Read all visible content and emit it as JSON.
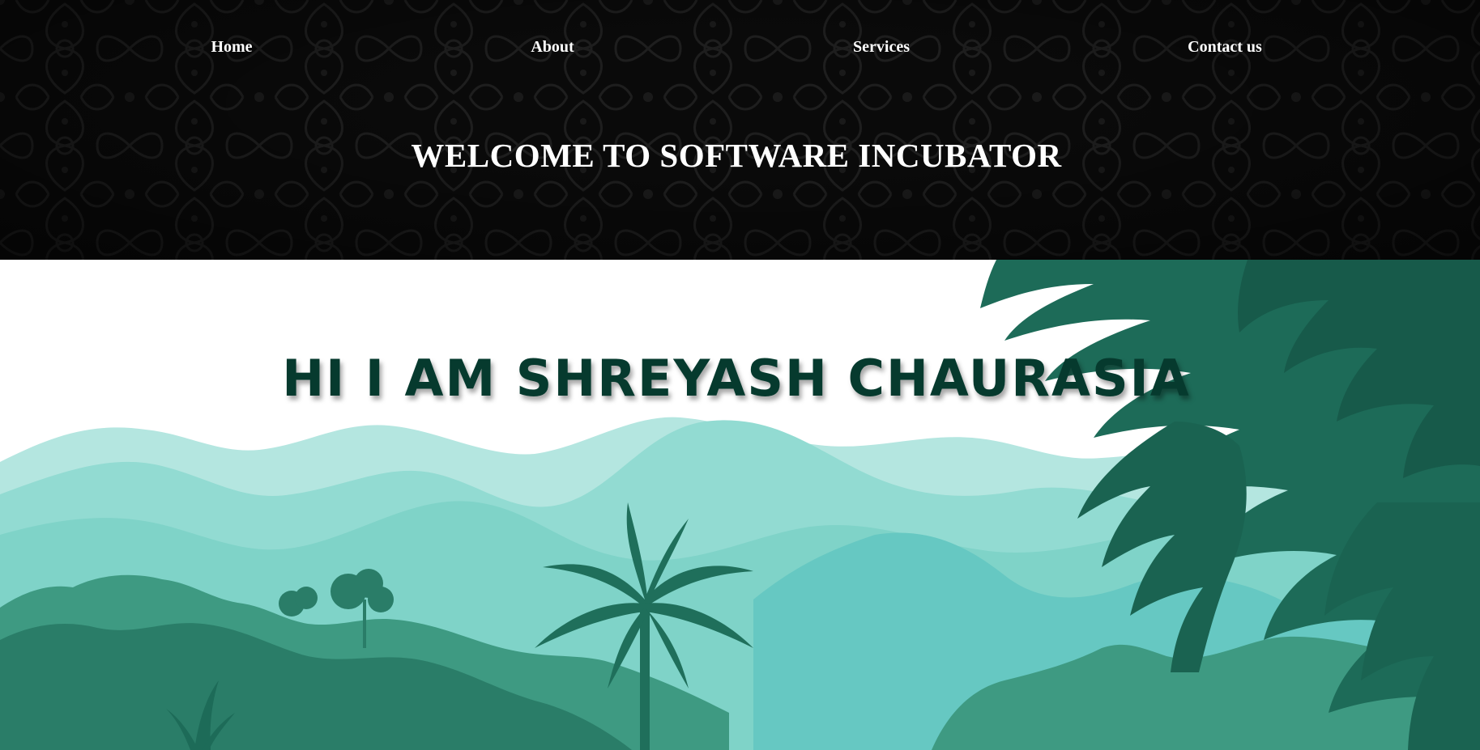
{
  "nav": {
    "items": [
      {
        "label": "Home"
      },
      {
        "label": "About"
      },
      {
        "label": "Services"
      },
      {
        "label": "Contact us"
      }
    ]
  },
  "header": {
    "title": "WELCOME TO SOFTWARE INCUBATOR"
  },
  "hero": {
    "title": "HI I AM SHREYASH CHAURASIA"
  },
  "colors": {
    "header_bg": "#0a0a0a",
    "hero_title": "#063a2e",
    "sky_hill_light": "#b4e6e0",
    "hill_mid": "#92dbd2",
    "hill_teal": "#66c8c2",
    "forest_dark": "#2a7d68",
    "fern": "#1d6b58"
  }
}
